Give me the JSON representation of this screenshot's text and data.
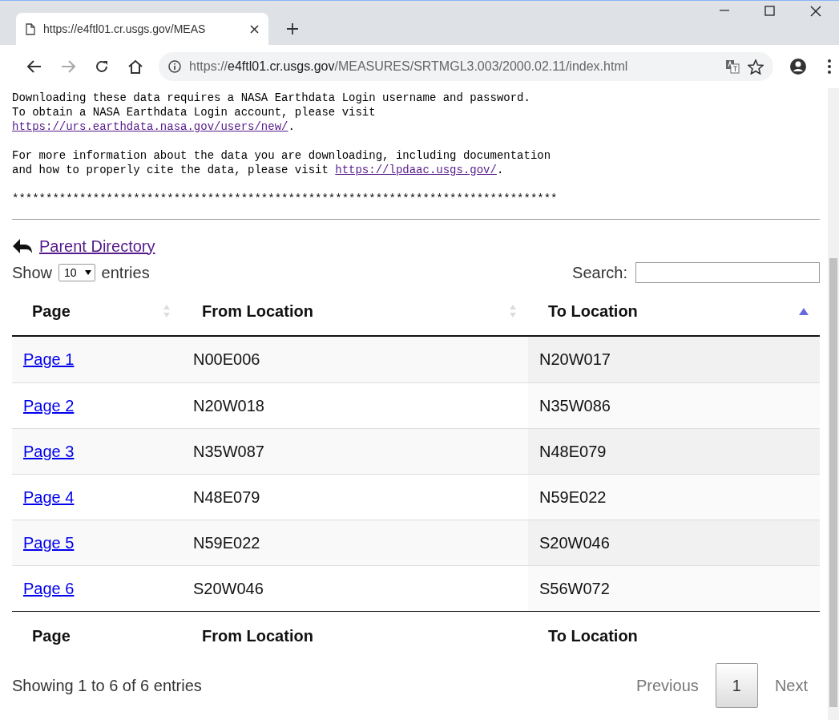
{
  "browser": {
    "tab": {
      "title": "https://e4ftl01.cr.usgs.gov/MEAS"
    },
    "address": {
      "scheme": "https://",
      "host": "e4ftl01.cr.usgs.gov",
      "path": "/MEASURES/SRTMGL3.003/2000.02.11/index.html"
    }
  },
  "notice": [
    {
      "text": "Downloading these data requires a NASA Earthdata Login username and password.\nTo obtain a NASA Earthdata Login account, please visit\n",
      "link": "https://urs.earthdata.nasa.gov/users/new/",
      "after": "."
    },
    {
      "text": "For more information about the data you are downloading, including documentation\nand how to properly cite the data, please visit ",
      "link": "https://lpdaac.usgs.gov/",
      "after": "."
    },
    {
      "text": "*********************************************************************************"
    }
  ],
  "parent_link": "Parent Directory",
  "length_menu": {
    "before": "Show",
    "value": "10",
    "after": "entries"
  },
  "search": {
    "label": "Search:"
  },
  "table": {
    "columns": [
      {
        "label": "Page",
        "sorted": false
      },
      {
        "label": "From Location",
        "sorted": false
      },
      {
        "label": "To Location",
        "sorted": true
      }
    ],
    "rows": [
      {
        "page": "Page 1",
        "from": "N00E006",
        "to": "N20W017"
      },
      {
        "page": "Page 2",
        "from": "N20W018",
        "to": "N35W086"
      },
      {
        "page": "Page 3",
        "from": "N35W087",
        "to": "N48E079"
      },
      {
        "page": "Page 4",
        "from": "N48E079",
        "to": "N59E022"
      },
      {
        "page": "Page 5",
        "from": "N59E022",
        "to": "S20W046"
      },
      {
        "page": "Page 6",
        "from": "S20W046",
        "to": "S56W072"
      }
    ],
    "footer": [
      "Page",
      "From Location",
      "To Location"
    ]
  },
  "info": "Showing 1 to 6 of 6 entries",
  "pagination": [
    {
      "label": "Previous",
      "disabled": true,
      "selected": false
    },
    {
      "label": "1",
      "disabled": false,
      "selected": true
    },
    {
      "label": "Next",
      "disabled": true,
      "selected": false
    }
  ]
}
